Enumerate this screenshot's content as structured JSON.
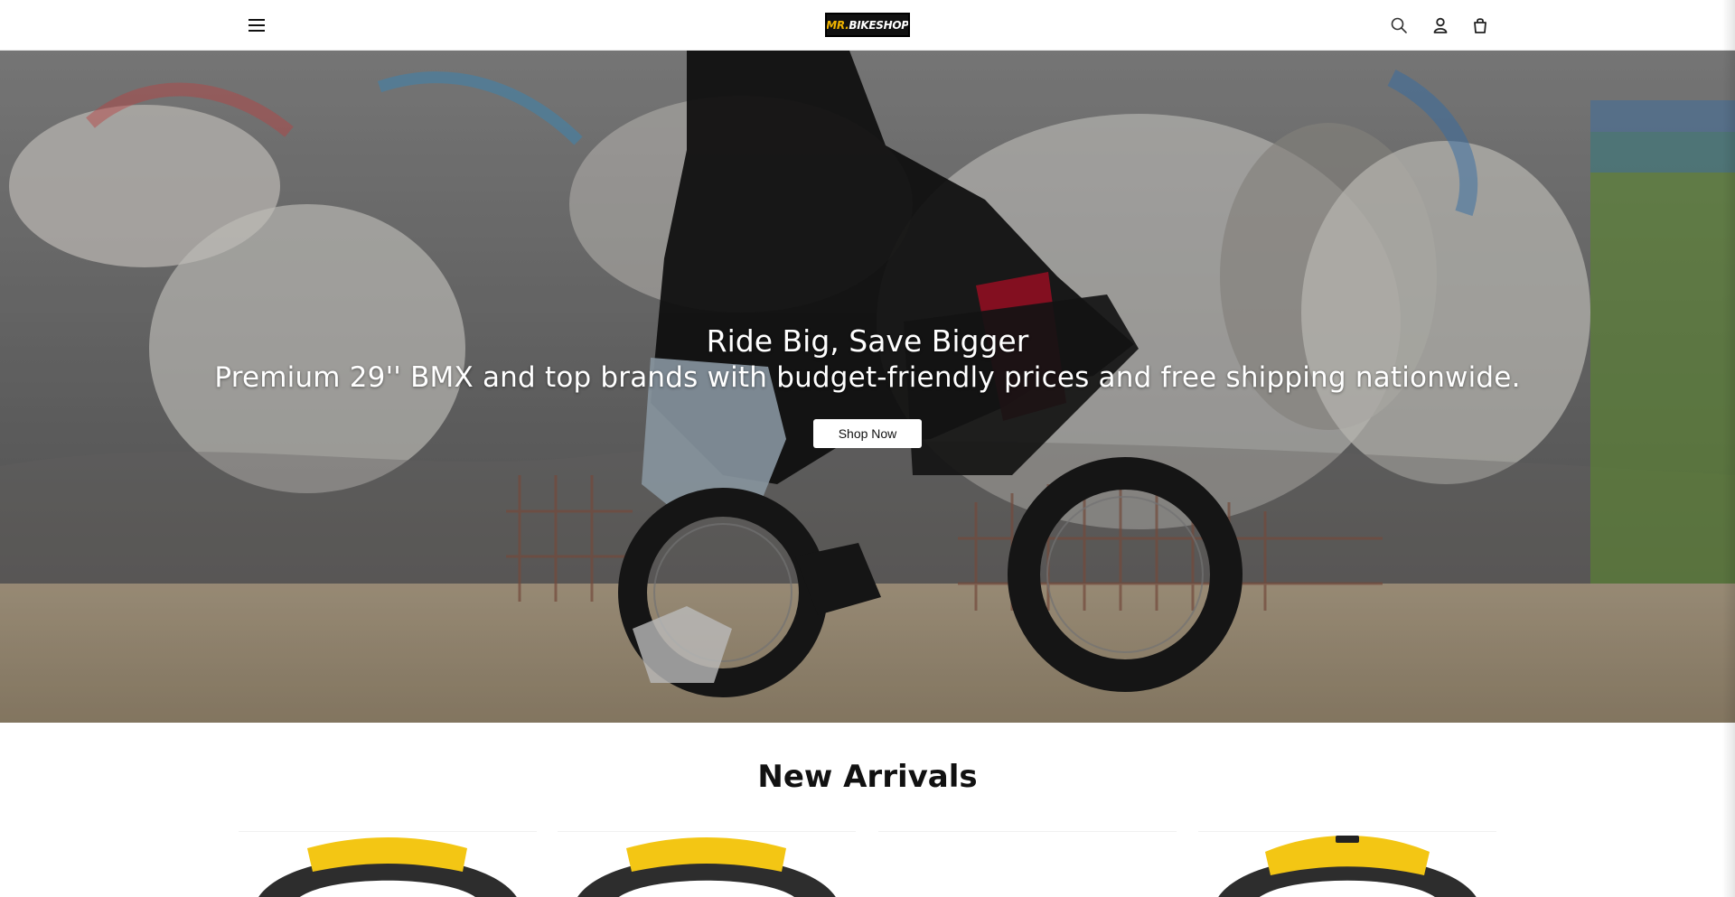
{
  "header": {
    "logo_mr": "MR.",
    "logo_bikeshop": "BIKESHOP",
    "menu_icon": "hamburger-menu-icon",
    "search_icon": "search-icon",
    "account_icon": "user-icon",
    "cart_icon": "shopping-bag-icon"
  },
  "hero": {
    "title": "Ride Big, Save Bigger",
    "subtitle": "Premium 29'' BMX and top brands with budget-friendly prices and free shipping nationwide.",
    "button_label": "Shop Now"
  },
  "new_arrivals": {
    "title": "New Arrivals",
    "products": [
      {
        "image": "yellow-black-saddle"
      },
      {
        "image": "yellow-black-saddle"
      },
      {
        "image": "blank"
      },
      {
        "image": "yellow-black-saddle"
      }
    ]
  },
  "colors": {
    "accent_yellow": "#f3c614",
    "header_bg": "#ffffff",
    "text_dark": "#111111"
  }
}
